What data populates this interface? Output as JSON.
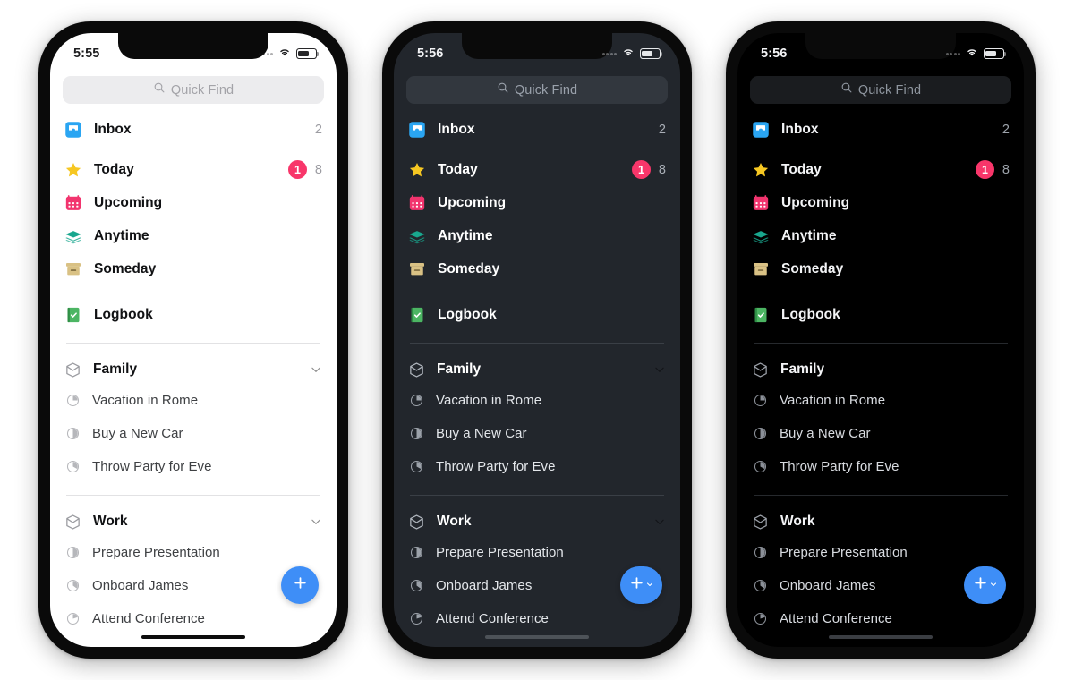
{
  "mockup": {
    "description": "Three iPhone mockups of a Things-style task manager sidebar in light, dark-gray and black themes",
    "accent_blue": "#3e8ef7",
    "badge_red": "#f8366a"
  },
  "phones": [
    {
      "theme": "light",
      "status": {
        "clock": "5:55",
        "signal_icon": "signal-dots-icon",
        "wifi_icon": "wifi-icon",
        "battery_icon": "battery-icon"
      },
      "search": {
        "placeholder": "Quick Find",
        "icon": "search-icon"
      },
      "fab": {
        "icon": "plus-icon",
        "chevron": "chevron-down-icon",
        "wide": false
      }
    },
    {
      "theme": "dark",
      "status": {
        "clock": "5:56",
        "signal_icon": "signal-dots-icon",
        "wifi_icon": "wifi-icon",
        "battery_icon": "battery-icon"
      },
      "search": {
        "placeholder": "Quick Find",
        "icon": "search-icon"
      },
      "fab": {
        "icon": "plus-icon",
        "chevron": "chevron-down-icon",
        "wide": true
      }
    },
    {
      "theme": "black",
      "status": {
        "clock": "5:56",
        "signal_icon": "signal-dots-icon",
        "wifi_icon": "wifi-icon",
        "battery_icon": "battery-icon"
      },
      "search": {
        "placeholder": "Quick Find",
        "icon": "search-icon"
      },
      "fab": {
        "icon": "plus-icon",
        "chevron": "chevron-down-icon",
        "wide": true
      }
    }
  ],
  "sidebar": {
    "smart_lists": [
      {
        "label": "Inbox",
        "icon": "inbox-tray-icon",
        "color": "#2aa5f2",
        "count": "2",
        "badge": ""
      },
      {
        "label": "Today",
        "icon": "star-icon",
        "color": "#f6c722",
        "count": "8",
        "badge": "1"
      },
      {
        "label": "Upcoming",
        "icon": "calendar-icon",
        "color": "#f2346e",
        "count": "",
        "badge": ""
      },
      {
        "label": "Anytime",
        "icon": "layers-stack-icon",
        "color": "#19a78e",
        "count": "",
        "badge": ""
      },
      {
        "label": "Someday",
        "icon": "archive-box-icon",
        "color": "#d9c184",
        "count": "",
        "badge": ""
      },
      {
        "label": "Logbook",
        "icon": "book-check-icon",
        "color": "#4cb563",
        "count": "",
        "badge": ""
      }
    ],
    "groups": [
      {
        "label": "Family",
        "icon": "project-hex-icon",
        "chevron": "chevron-down-icon",
        "projects": [
          {
            "label": "Vacation in Rome",
            "progress": 25,
            "icon": "progress-pie-icon"
          },
          {
            "label": "Buy a New Car",
            "progress": 50,
            "icon": "progress-pie-icon"
          },
          {
            "label": "Throw Party for Eve",
            "progress": 33,
            "icon": "progress-pie-icon"
          }
        ]
      },
      {
        "label": "Work",
        "icon": "project-hex-icon",
        "chevron": "chevron-down-icon",
        "projects": [
          {
            "label": "Prepare Presentation",
            "progress": 50,
            "icon": "progress-pie-icon"
          },
          {
            "label": "Onboard James",
            "progress": 35,
            "icon": "progress-pie-icon"
          },
          {
            "label": "Attend Conference",
            "progress": 20,
            "icon": "progress-pie-icon"
          }
        ]
      }
    ]
  }
}
